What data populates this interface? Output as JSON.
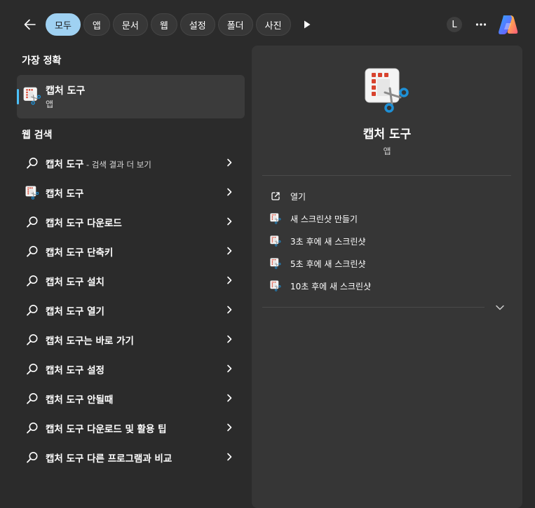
{
  "tabs": [
    {
      "label": "모두",
      "active": true
    },
    {
      "label": "앱",
      "active": false
    },
    {
      "label": "문서",
      "active": false
    },
    {
      "label": "웹",
      "active": false
    },
    {
      "label": "설정",
      "active": false
    },
    {
      "label": "폴더",
      "active": false
    },
    {
      "label": "사진",
      "active": false
    }
  ],
  "account": {
    "initial": "L"
  },
  "best_match": {
    "heading": "가장 정확",
    "title": "캡처 도구",
    "subtitle": "앱"
  },
  "web": {
    "heading": "웹 검색",
    "results": [
      {
        "icon": "search-icon",
        "prefix": "캡처 도구",
        "bold": "",
        "suffix": " - 검색 결과 더 보기"
      },
      {
        "icon": "snipping-tool-icon",
        "prefix": "캡처 도구",
        "bold": "",
        "suffix": ""
      },
      {
        "icon": "search-icon",
        "prefix": "캡처 도구 ",
        "bold": "다운로드",
        "suffix": ""
      },
      {
        "icon": "search-icon",
        "prefix": "캡처 도구 ",
        "bold": "단축키",
        "suffix": ""
      },
      {
        "icon": "search-icon",
        "prefix": "캡처 도구 ",
        "bold": "설치",
        "suffix": ""
      },
      {
        "icon": "search-icon",
        "prefix": "캡처 도구 ",
        "bold": "열기",
        "suffix": ""
      },
      {
        "icon": "search-icon",
        "prefix": "캡처 도구",
        "bold": "는 바로 가기",
        "suffix": ""
      },
      {
        "icon": "search-icon",
        "prefix": "캡처 도구 ",
        "bold": "설정",
        "suffix": ""
      },
      {
        "icon": "search-icon",
        "prefix": "캡처 도구 ",
        "bold": "안될때",
        "suffix": ""
      },
      {
        "icon": "search-icon",
        "prefix": "캡처 도구 ",
        "bold": "다운로드 및 활용 팁",
        "suffix": ""
      },
      {
        "icon": "search-icon",
        "prefix": "캡처 도구 ",
        "bold": "다른 프로그램과 비교",
        "suffix": ""
      }
    ]
  },
  "detail": {
    "app_name": "캡처 도구",
    "app_type": "앱",
    "actions": [
      {
        "icon": "open-external-icon",
        "label": "열기"
      },
      {
        "icon": "snipping-tool-icon",
        "label": "새 스크린샷 만들기"
      },
      {
        "icon": "snipping-tool-icon",
        "label": "3초 후에 새 스크린샷"
      },
      {
        "icon": "snipping-tool-icon",
        "label": "5초 후에 새 스크린샷"
      },
      {
        "icon": "snipping-tool-icon",
        "label": "10초 후에 새 스크린샷"
      }
    ]
  },
  "colors": {
    "background": "#2b2b2b",
    "panel": "#363636",
    "accent": "#4cc2ff",
    "active_tab": "#9fd1f2"
  }
}
